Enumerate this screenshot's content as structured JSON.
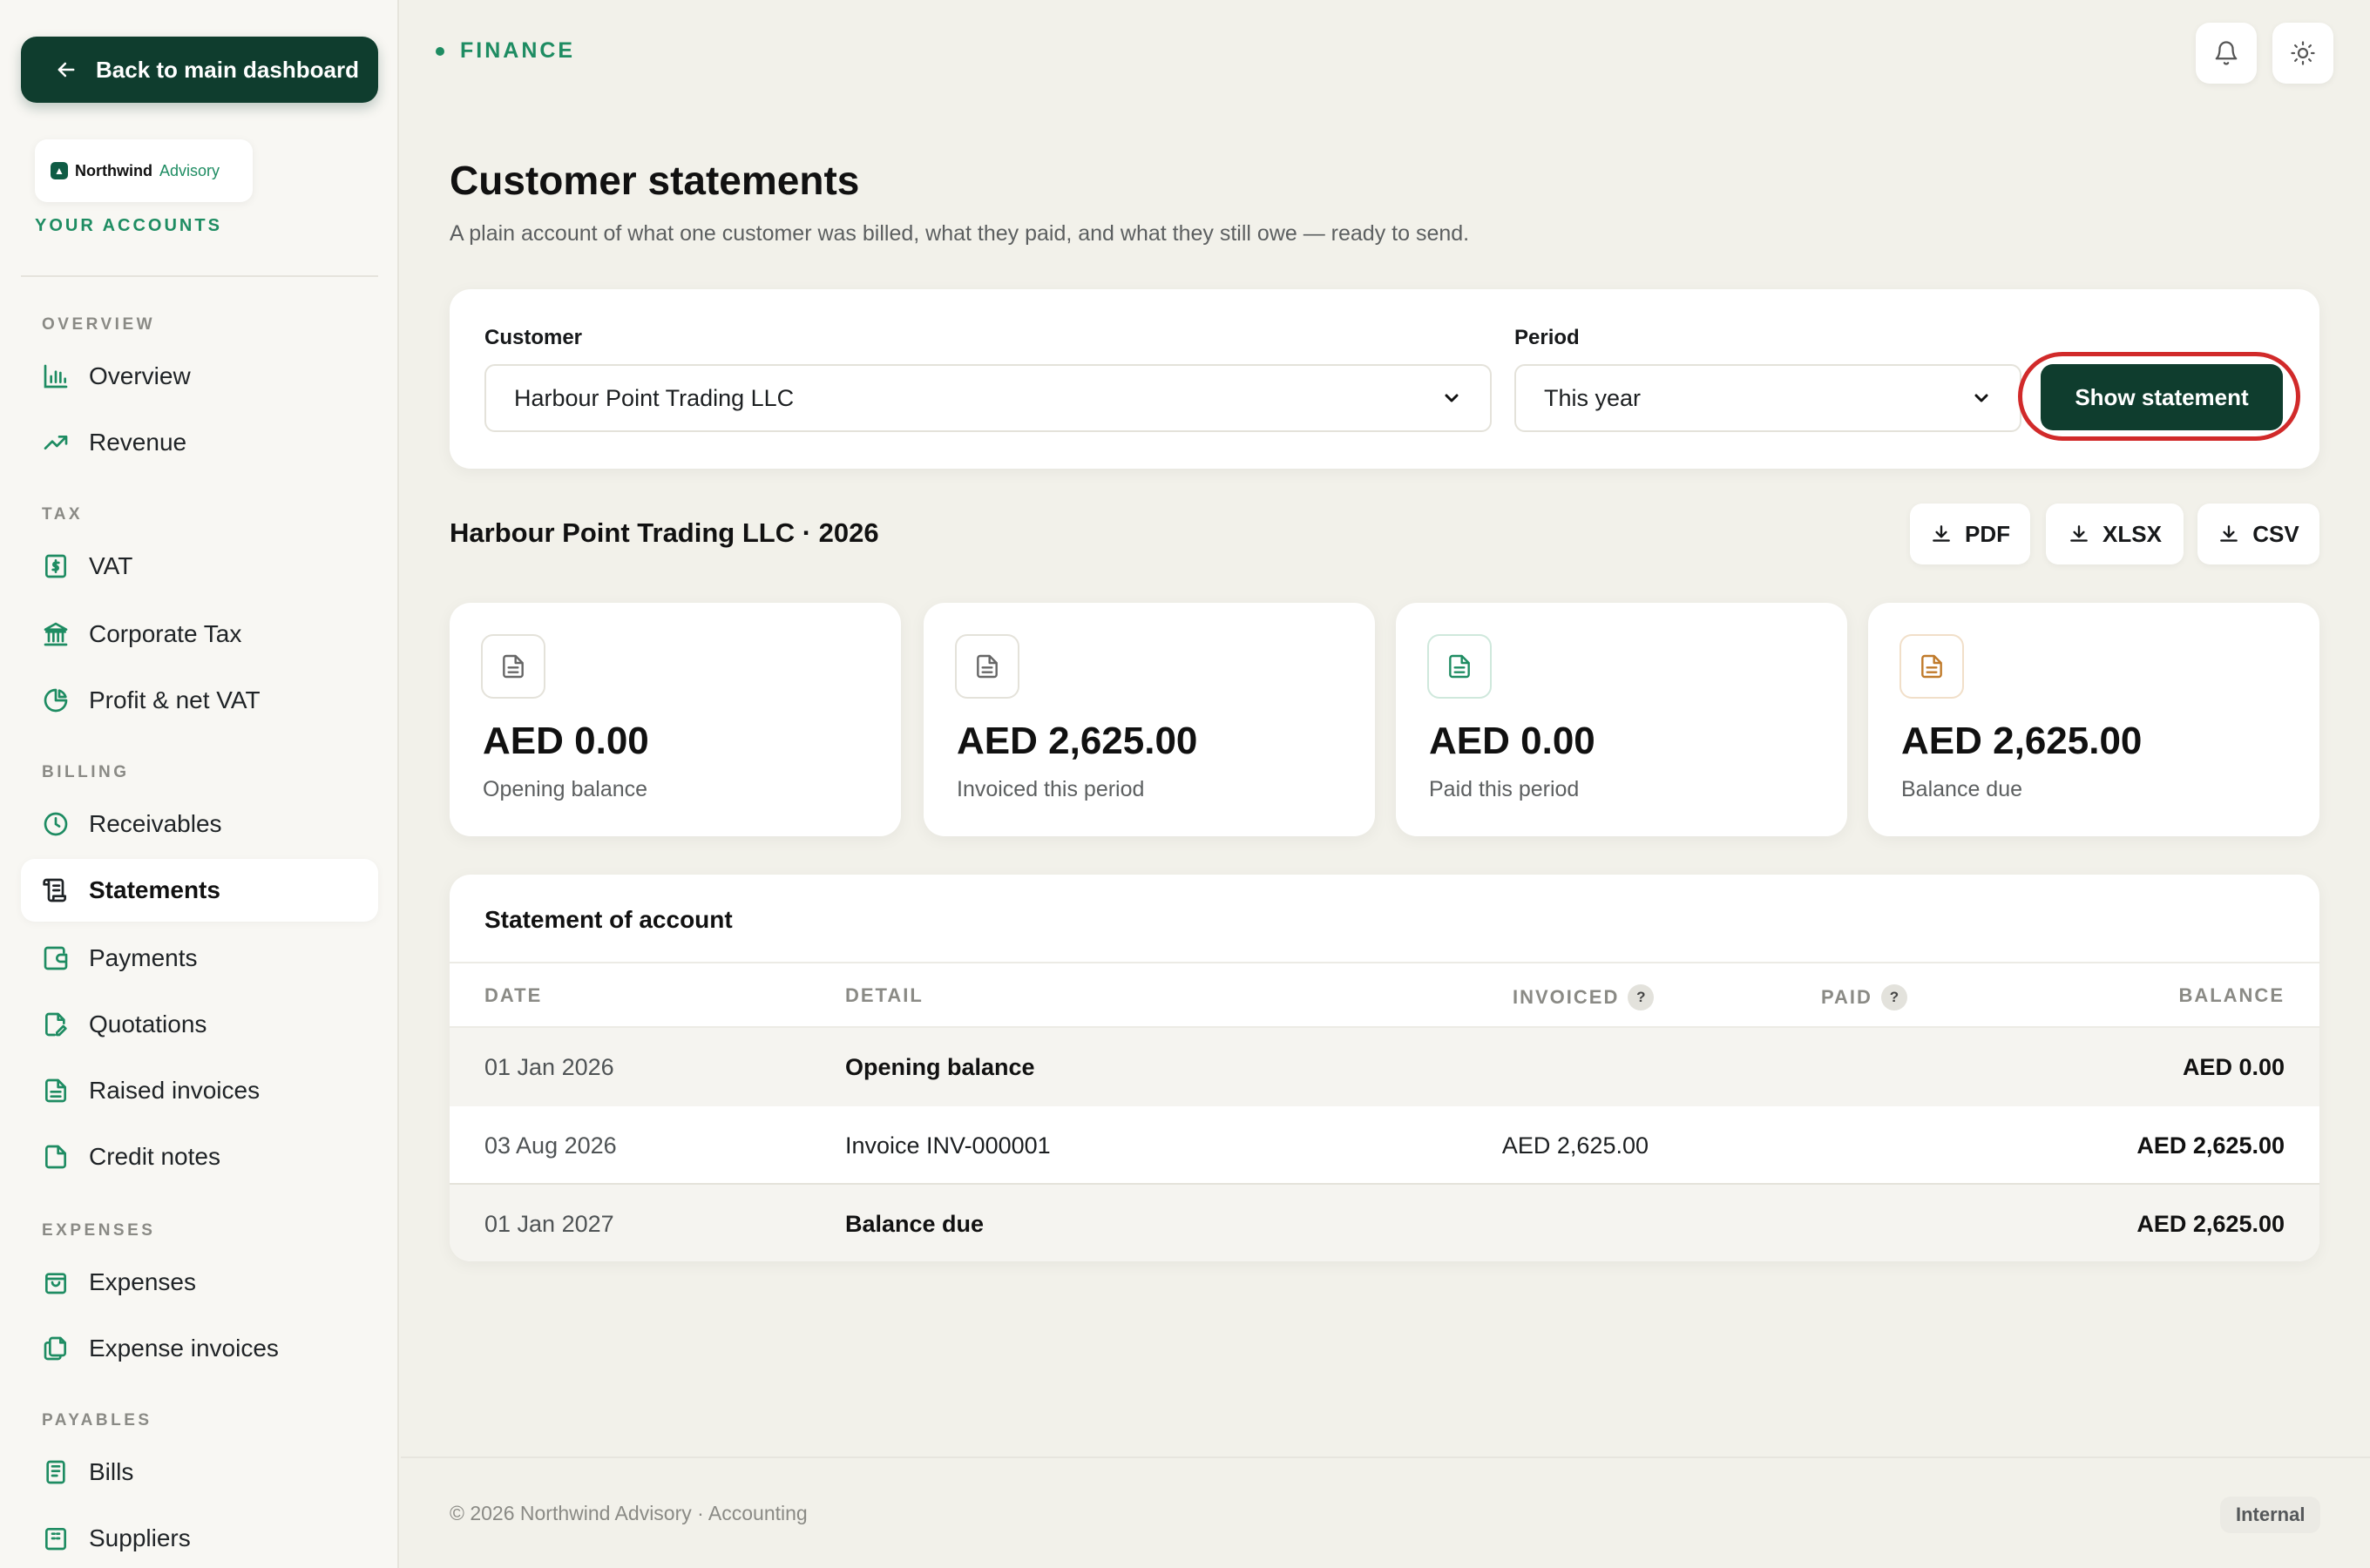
{
  "sidebar": {
    "back_label": "Back to main dashboard",
    "brand": {
      "name": "Northwind",
      "sub": "Advisory"
    },
    "accounts_label": "YOUR ACCOUNTS",
    "sections": {
      "overview": "OVERVIEW",
      "tax": "TAX",
      "billing": "BILLING",
      "expenses": "EXPENSES",
      "payables": "PAYABLES"
    },
    "items": {
      "overview": "Overview",
      "revenue": "Revenue",
      "vat": "VAT",
      "corporate_tax": "Corporate Tax",
      "profit_vat": "Profit & net VAT",
      "receivables": "Receivables",
      "statements": "Statements",
      "payments": "Payments",
      "quotations": "Quotations",
      "raised_invoices": "Raised invoices",
      "credit_notes": "Credit notes",
      "expenses": "Expenses",
      "expense_invoices": "Expense invoices",
      "bills": "Bills",
      "suppliers": "Suppliers"
    },
    "active_item": "Statements"
  },
  "header": {
    "breadcrumb": "FINANCE",
    "title": "Customer statements",
    "subtitle": "A plain account of what one customer was billed, what they paid, and what they still owe — ready to send."
  },
  "filters": {
    "customer_label": "Customer",
    "customer_value": "Harbour Point Trading LLC",
    "period_label": "Period",
    "period_value": "This year",
    "show_label": "Show statement"
  },
  "statement": {
    "heading": "Harbour Point Trading LLC · 2026",
    "exports": {
      "pdf": "PDF",
      "xlsx": "XLSX",
      "csv": "CSV"
    }
  },
  "kpis": [
    {
      "value": "AED 0.00",
      "label": "Opening balance"
    },
    {
      "value": "AED 2,625.00",
      "label": "Invoiced this period"
    },
    {
      "value": "AED 0.00",
      "label": "Paid this period"
    },
    {
      "value": "AED 2,625.00",
      "label": "Balance due"
    }
  ],
  "table": {
    "title": "Statement of account",
    "headers": {
      "date": "DATE",
      "detail": "DETAIL",
      "invoiced": "INVOICED",
      "paid": "PAID",
      "balance": "BALANCE"
    },
    "help_glyph": "?",
    "rows": [
      {
        "date": "01 Jan 2026",
        "detail": "Opening balance",
        "invoiced": "",
        "paid": "",
        "balance": "AED 0.00"
      },
      {
        "date": "03 Aug 2026",
        "detail": "Invoice INV-000001",
        "invoiced": "AED 2,625.00",
        "paid": "",
        "balance": "AED 2,625.00"
      },
      {
        "date": "01 Jan 2027",
        "detail": "Balance due",
        "invoiced": "",
        "paid": "",
        "balance": "AED 2,625.00"
      }
    ]
  },
  "footer": {
    "copyright": "© 2026 Northwind Advisory · Accounting",
    "badge": "Internal"
  },
  "colors": {
    "accent": "#1e8c62",
    "primary_button": "#0f3d2e",
    "highlight": "#d12a2a",
    "background": "#f2f1ea"
  },
  "icons": {
    "back": "arrow-left-icon",
    "overview": "bar-chart-icon",
    "revenue": "trend-up-icon",
    "vat": "dollar-doc-icon",
    "corporate_tax": "bank-icon",
    "profit_vat": "pie-chart-icon",
    "receivables": "clock-icon",
    "statements": "scroll-icon",
    "payments": "wallet-icon",
    "quotations": "edit-doc-icon",
    "raised_invoices": "doc-icon",
    "credit_notes": "doc-icon",
    "expenses": "bag-icon",
    "expense_invoices": "copy-doc-icon",
    "bills": "receipt-icon",
    "notifications": "bell-icon",
    "theme": "sun-icon",
    "download": "download-icon"
  }
}
